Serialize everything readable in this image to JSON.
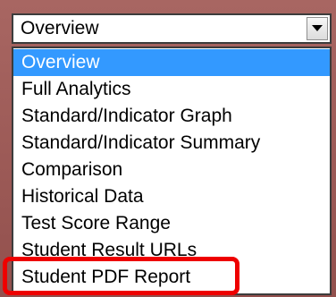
{
  "dropdown": {
    "selected_value": "Overview",
    "arrow_icon": "chevron-down-icon",
    "options": [
      {
        "label": "Overview",
        "selected": true
      },
      {
        "label": "Full Analytics",
        "selected": false
      },
      {
        "label": "Standard/Indicator Graph",
        "selected": false
      },
      {
        "label": "Standard/Indicator Summary",
        "selected": false
      },
      {
        "label": "Comparison",
        "selected": false
      },
      {
        "label": "Historical Data",
        "selected": false
      },
      {
        "label": "Test Score Range",
        "selected": false
      },
      {
        "label": "Student Result URLs",
        "selected": false
      },
      {
        "label": "Student PDF Report",
        "selected": false
      }
    ]
  },
  "annotation": {
    "highlighted_option": "Student PDF Report",
    "color": "#ee0000"
  },
  "colors": {
    "selection": "#3399ff",
    "background": "#9a5a56"
  }
}
